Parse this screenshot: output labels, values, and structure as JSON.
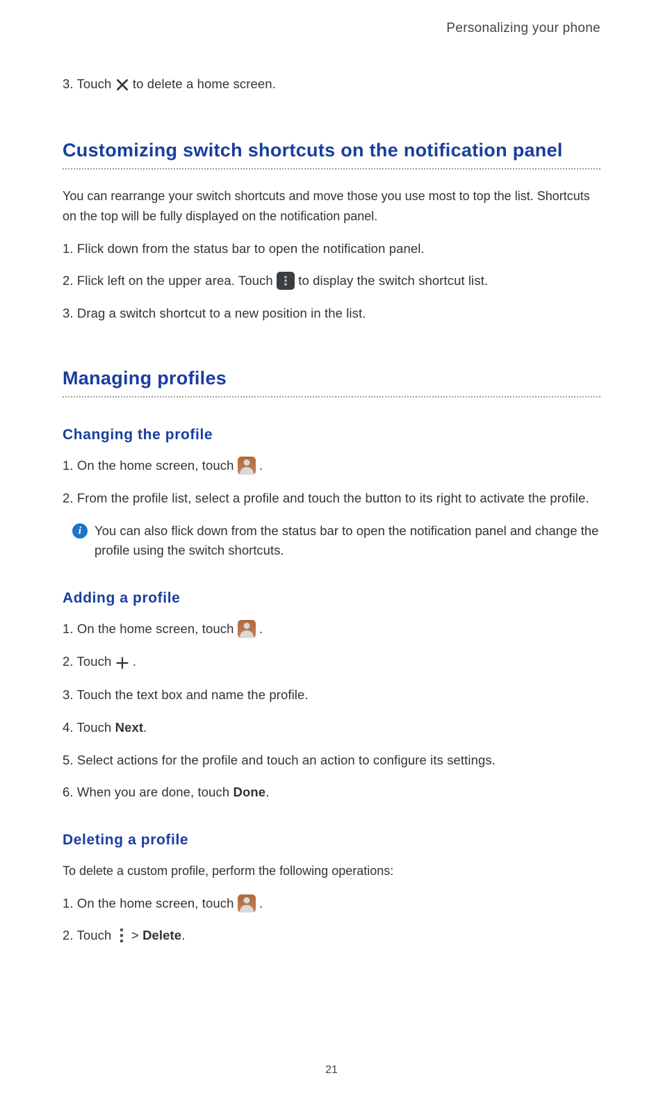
{
  "header": "Personalizing your phone",
  "footer": "21",
  "intro_step": {
    "num": "3.",
    "pre": "Touch ",
    "post": " to delete a home screen."
  },
  "section_custom": {
    "title": "Customizing switch shortcuts on the notification panel",
    "intro": "You can rearrange your switch shortcuts and move those you use most to top the list. Shortcuts on the top will be fully displayed on the notification panel.",
    "steps": {
      "s1": {
        "num": "1.",
        "text": "Flick down from the status bar to open the notification panel."
      },
      "s2": {
        "num": "2.",
        "pre": "Flick left on the upper area. Touch ",
        "post": " to display the switch shortcut list."
      },
      "s3": {
        "num": "3.",
        "text": "Drag a switch shortcut to a new position in the list."
      }
    }
  },
  "section_profiles": {
    "title": "Managing profiles",
    "changing": {
      "title": "Changing  the  profile",
      "s1": {
        "num": "1.",
        "pre": "On the home screen, touch ",
        "post": " ."
      },
      "s2": {
        "num": "2.",
        "text": "From the profile list, select a profile and touch the button to its right to activate the profile."
      },
      "note": "You can also flick down from the status bar to open the notification panel and change the profile using the switch shortcuts."
    },
    "adding": {
      "title": "Adding  a  profile",
      "s1": {
        "num": "1.",
        "pre": "On the home screen, touch ",
        "post": " ."
      },
      "s2": {
        "num": "2.",
        "pre": "Touch ",
        "post": " ."
      },
      "s3": {
        "num": "3.",
        "text": "Touch the text box and name the profile."
      },
      "s4": {
        "num": "4.",
        "pre": "Touch ",
        "bold": "Next",
        "post": "."
      },
      "s5": {
        "num": "5.",
        "text": "Select actions for the profile and touch an action to configure its settings."
      },
      "s6": {
        "num": "6.",
        "pre": "When you are done, touch ",
        "bold": "Done",
        "post": "."
      }
    },
    "deleting": {
      "title": "Deleting  a  profile",
      "intro": "To delete a custom profile, perform the following operations:",
      "s1": {
        "num": "1.",
        "pre": "On the home screen, touch ",
        "post": " ."
      },
      "s2": {
        "num": "2.",
        "pre": "Touch ",
        "mid": "  > ",
        "bold": "Delete",
        "post": "."
      }
    }
  }
}
